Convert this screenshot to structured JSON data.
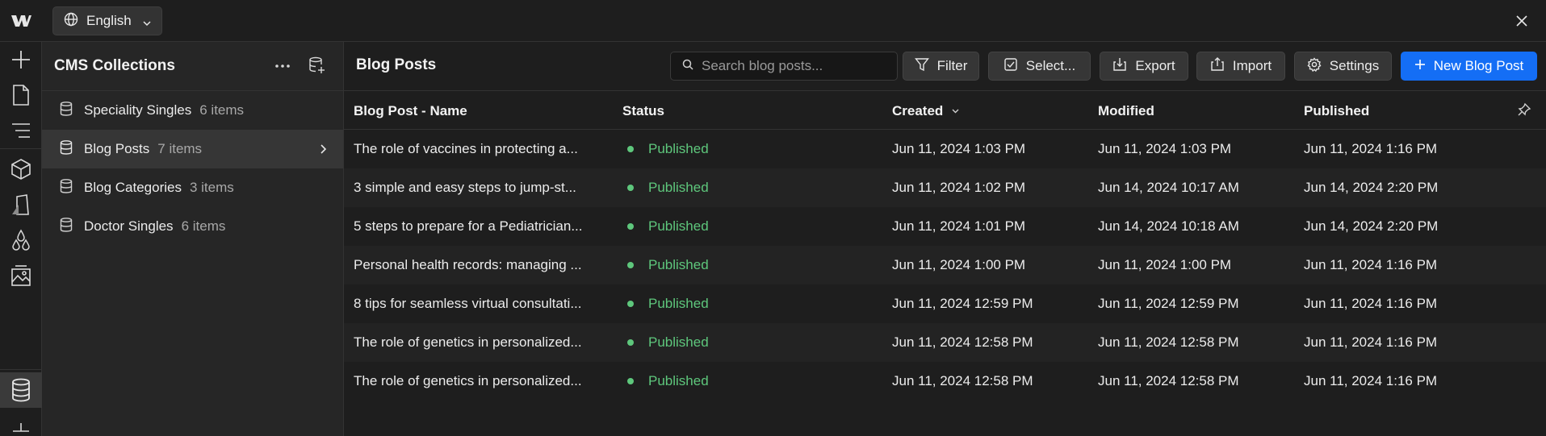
{
  "app": {
    "language": "English",
    "colors": {
      "accent": "#146ef5",
      "published": "#5ec77c"
    }
  },
  "rail": {
    "icons": [
      "plus-icon",
      "page-icon",
      "navigator-icon",
      "components-icon",
      "style-icon",
      "variables-icon",
      "assets-icon",
      "cms-icon",
      "apps-icon"
    ]
  },
  "collections": {
    "title": "CMS Collections",
    "items": [
      {
        "name": "Speciality Singles",
        "count": "6 items"
      },
      {
        "name": "Blog Posts",
        "count": "7 items"
      },
      {
        "name": "Blog Categories",
        "count": "3 items"
      },
      {
        "name": "Doctor Singles",
        "count": "6 items"
      }
    ]
  },
  "main": {
    "title": "Blog Posts",
    "search_placeholder": "Search blog posts...",
    "buttons": {
      "filter": "Filter",
      "select": "Select...",
      "export": "Export",
      "import": "Import",
      "settings": "Settings",
      "new": "New Blog Post"
    },
    "columns": {
      "name": "Blog Post - Name",
      "status": "Status",
      "created": "Created",
      "modified": "Modified",
      "published": "Published"
    },
    "rows": [
      {
        "name": "The role of vaccines in protecting a...",
        "status": "Published",
        "created": "Jun 11, 2024 1:03 PM",
        "modified": "Jun 11, 2024 1:03 PM",
        "published": "Jun 11, 2024 1:16 PM"
      },
      {
        "name": "3 simple and easy steps to jump-st...",
        "status": "Published",
        "created": "Jun 11, 2024 1:02 PM",
        "modified": "Jun 14, 2024 10:17 AM",
        "published": "Jun 14, 2024 2:20 PM"
      },
      {
        "name": "5 steps to prepare for a Pediatrician...",
        "status": "Published",
        "created": "Jun 11, 2024 1:01 PM",
        "modified": "Jun 14, 2024 10:18 AM",
        "published": "Jun 14, 2024 2:20 PM"
      },
      {
        "name": "Personal health records: managing ...",
        "status": "Published",
        "created": "Jun 11, 2024 1:00 PM",
        "modified": "Jun 11, 2024 1:00 PM",
        "published": "Jun 11, 2024 1:16 PM"
      },
      {
        "name": "8 tips for seamless virtual consultati...",
        "status": "Published",
        "created": "Jun 11, 2024 12:59 PM",
        "modified": "Jun 11, 2024 12:59 PM",
        "published": "Jun 11, 2024 1:16 PM"
      },
      {
        "name": "The role of genetics in personalized...",
        "status": "Published",
        "created": "Jun 11, 2024 12:58 PM",
        "modified": "Jun 11, 2024 12:58 PM",
        "published": "Jun 11, 2024 1:16 PM"
      },
      {
        "name": "The role of genetics in personalized...",
        "status": "Published",
        "created": "Jun 11, 2024 12:58 PM",
        "modified": "Jun 11, 2024 12:58 PM",
        "published": "Jun 11, 2024 1:16 PM"
      }
    ]
  }
}
